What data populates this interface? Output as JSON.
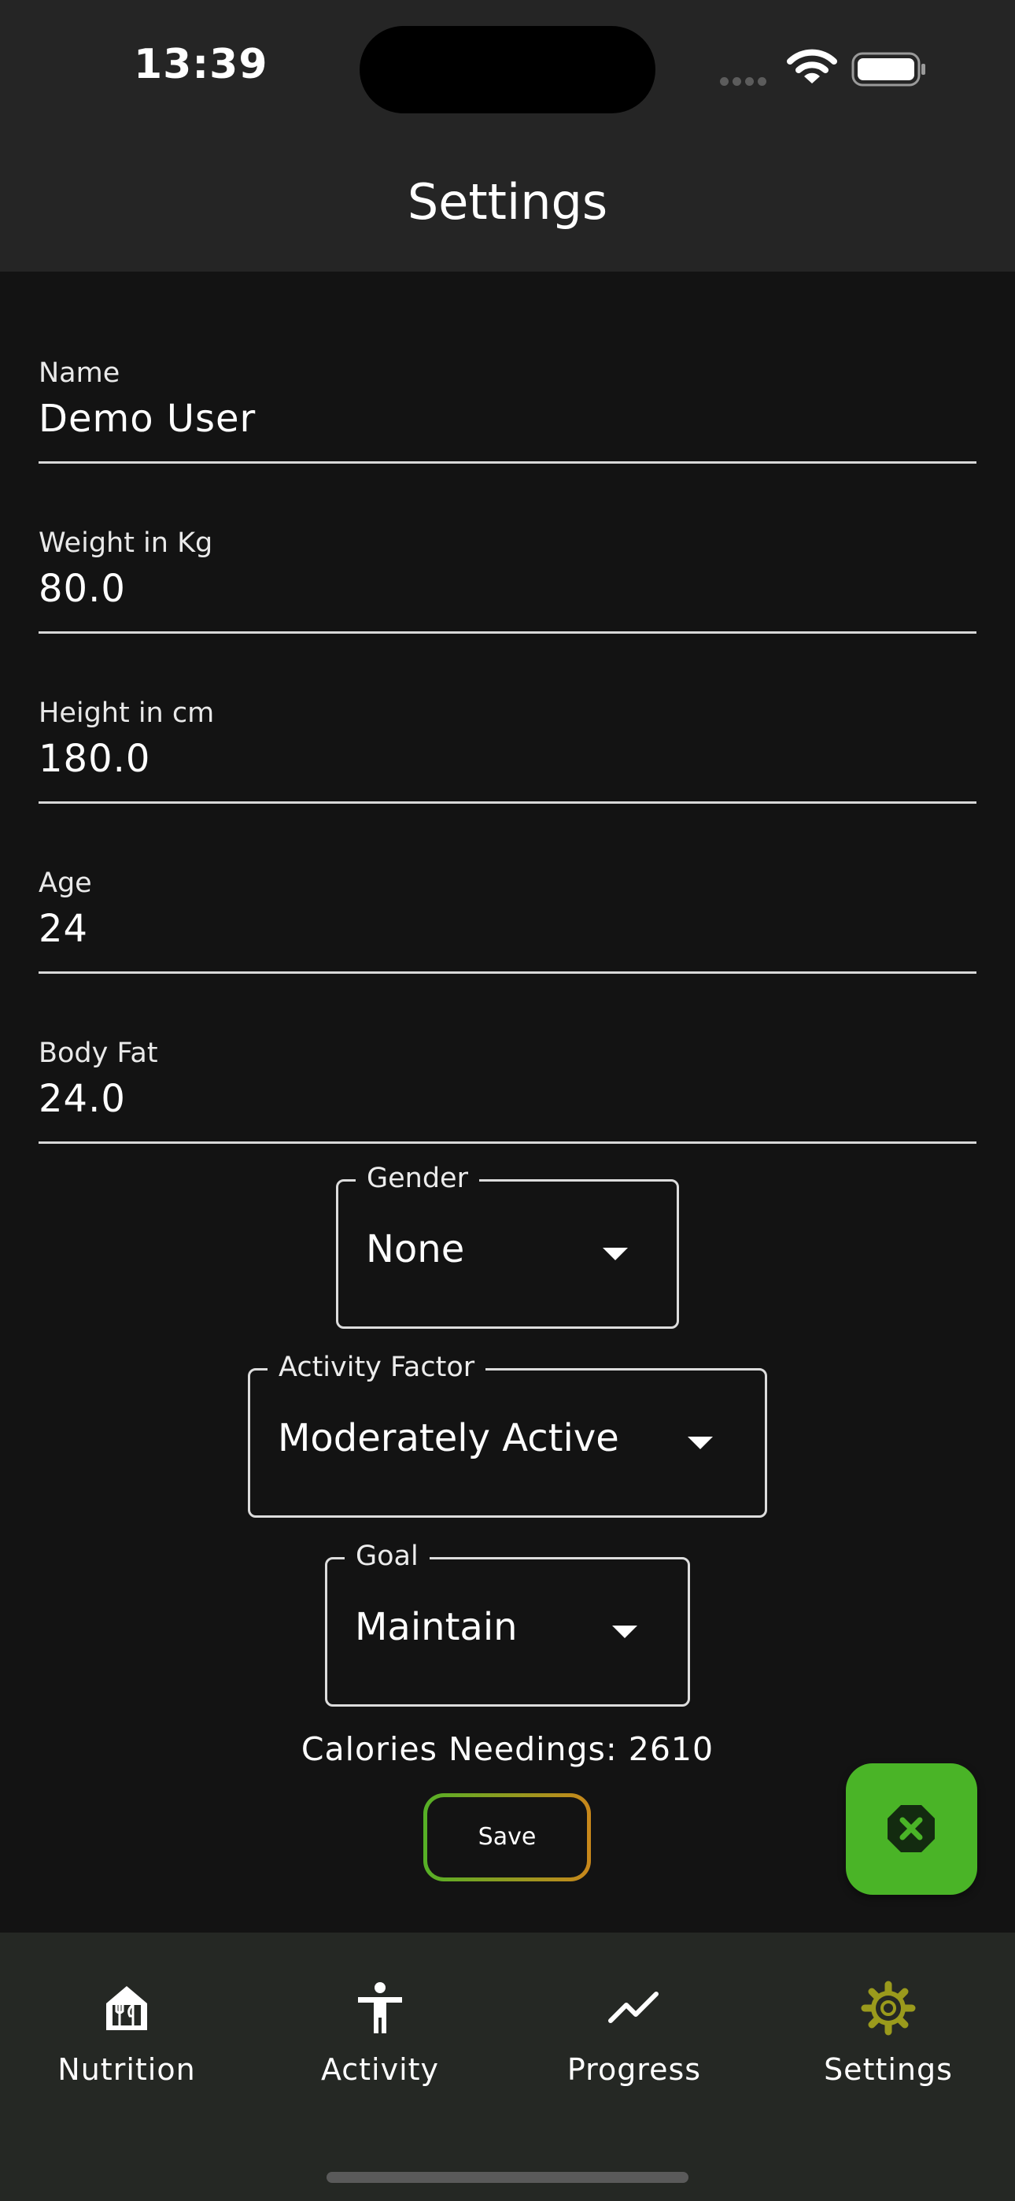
{
  "status_bar": {
    "time": "13:39"
  },
  "app_bar": {
    "title": "Settings"
  },
  "fields": [
    {
      "label": "Name",
      "value": "Demo User"
    },
    {
      "label": "Weight in Kg",
      "value": "80.0"
    },
    {
      "label": "Height in cm",
      "value": "180.0"
    },
    {
      "label": "Age",
      "value": "24"
    },
    {
      "label": "Body Fat",
      "value": "24.0"
    }
  ],
  "dropdowns": {
    "gender": {
      "label": "Gender",
      "value": "None"
    },
    "activity": {
      "label": "Activity Factor",
      "value": "Moderately Active"
    },
    "goal": {
      "label": "Goal",
      "value": "Maintain"
    }
  },
  "calories_text": "Calories Needings: 2610",
  "save_label": "Save",
  "nav": {
    "items": [
      {
        "label": "Nutrition",
        "icon": "nutrition-icon"
      },
      {
        "label": "Activity",
        "icon": "person-icon"
      },
      {
        "label": "Progress",
        "icon": "trending-up-icon"
      },
      {
        "label": "Settings",
        "icon": "gear-icon",
        "active": true
      }
    ]
  },
  "colors": {
    "background": "#131313",
    "bar": "#252525",
    "fab": "#4ab427",
    "active_nav_icon": "#9a9a1c"
  }
}
